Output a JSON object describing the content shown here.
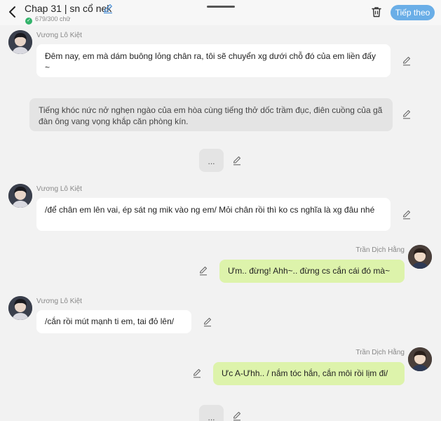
{
  "header": {
    "title": "Chap 31 | sn cổ nek",
    "word_count": "679/300 chữ",
    "next_label": "Tiếp theo",
    "accent_color": "#6aaee7"
  },
  "messages": [
    {
      "type": "character",
      "speaker": "Vương Lô Kiệt",
      "text": "Đêm nay, em mà dám buông lỏng chân ra, tôi sẽ chuyển xg dưới chỗ đó của em liền đấy ~"
    },
    {
      "type": "narration",
      "text": "Tiếng khóc nức nở nghẹn ngào của em hòa cùng tiếng thở dốc trầm đục, điên cuồng của gã đàn ông vang vọng khắp căn phòng kín."
    },
    {
      "type": "placeholder",
      "text": "..."
    },
    {
      "type": "character",
      "speaker": "Vương Lô Kiệt",
      "text": "/để chân em lên vai, ép sát ng mik vào ng em/ Mỏi chân rồi thì ko cs nghĩa là xg đâu nhé"
    },
    {
      "type": "self",
      "speaker": "Trần Dịch Hằng",
      "text": "Ưm.. đừng! Ahh~.. đừng cs cắn cái đó mà~"
    },
    {
      "type": "character",
      "speaker": "Vương Lô Kiệt",
      "text": "/cắn rồi mút mạnh ti em, tai đỏ lên/"
    },
    {
      "type": "self",
      "speaker": "Trần Dịch Hằng",
      "text": "Ưc A-Ưhh.. / nắm tóc hắn, cắn môi rồi lịm đi/"
    },
    {
      "type": "placeholder",
      "text": "..."
    }
  ]
}
